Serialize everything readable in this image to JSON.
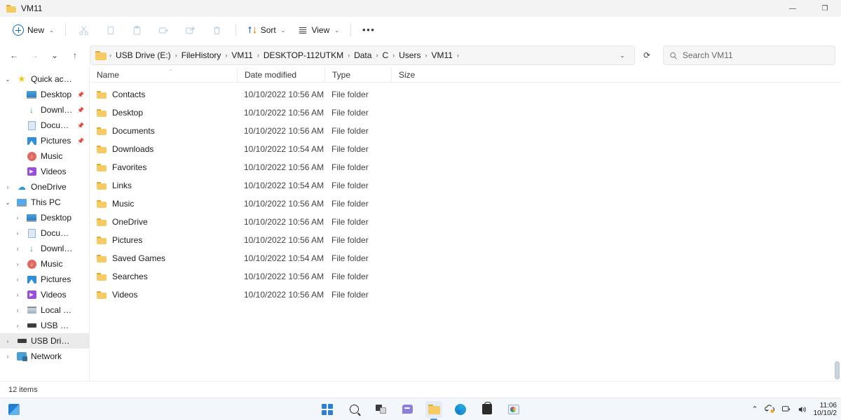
{
  "window": {
    "title": "VM11",
    "title_icon": "folder-icon",
    "controls": {
      "minimize": "—",
      "maximize": "❐",
      "close": "✕"
    }
  },
  "toolbar": {
    "new_label": "New",
    "new_caret": "⌄",
    "cut_icon": "cut-icon",
    "copy_icon": "copy-icon",
    "paste_icon": "paste-icon",
    "rename_icon": "rename-icon",
    "share_icon": "share-icon",
    "delete_icon": "delete-icon",
    "sort_label": "Sort",
    "sort_icon": "sort-icon",
    "view_label": "View",
    "view_icon": "view-icon",
    "more_label": "•••"
  },
  "address": {
    "back_icon": "←",
    "forward_icon": "→",
    "recent_icon": "⌄",
    "up_icon": "↑",
    "folder_icon": "folder-icon",
    "separator": "›",
    "crumbs": [
      "USB Drive (E:)",
      "FileHistory",
      "VM11",
      "DESKTOP-112UTKM",
      "Data",
      "C",
      "Users",
      "VM11"
    ],
    "dropdown_icon": "⌄",
    "refresh_icon": "⟳"
  },
  "search": {
    "icon": "search-icon",
    "placeholder": "Search VM11",
    "value": ""
  },
  "sidebar": {
    "items": [
      {
        "label": "Quick access",
        "icon": "star-icon",
        "indent": 0,
        "chevron": "open",
        "pinned": false,
        "selected": false
      },
      {
        "label": "Desktop",
        "icon": "desktop-icon",
        "indent": 1,
        "chevron": "none",
        "pinned": true,
        "selected": false
      },
      {
        "label": "Downloads",
        "icon": "download-icon",
        "indent": 1,
        "chevron": "none",
        "pinned": true,
        "selected": false
      },
      {
        "label": "Documents",
        "icon": "document-icon",
        "indent": 1,
        "chevron": "none",
        "pinned": true,
        "selected": false
      },
      {
        "label": "Pictures",
        "icon": "pictures-icon",
        "indent": 1,
        "chevron": "none",
        "pinned": true,
        "selected": false
      },
      {
        "label": "Music",
        "icon": "music-icon",
        "indent": 1,
        "chevron": "none",
        "pinned": false,
        "selected": false
      },
      {
        "label": "Videos",
        "icon": "video-icon",
        "indent": 1,
        "chevron": "none",
        "pinned": false,
        "selected": false
      },
      {
        "label": "OneDrive",
        "icon": "cloud-icon",
        "indent": 0,
        "chevron": "closed",
        "pinned": false,
        "selected": false
      },
      {
        "label": "This PC",
        "icon": "pc-icon",
        "indent": 0,
        "chevron": "open",
        "pinned": false,
        "selected": false
      },
      {
        "label": "Desktop",
        "icon": "desktop-icon",
        "indent": 1,
        "chevron": "closed",
        "pinned": false,
        "selected": false
      },
      {
        "label": "Documents",
        "icon": "document-icon",
        "indent": 1,
        "chevron": "closed",
        "pinned": false,
        "selected": false
      },
      {
        "label": "Downloads",
        "icon": "download-icon",
        "indent": 1,
        "chevron": "closed",
        "pinned": false,
        "selected": false
      },
      {
        "label": "Music",
        "icon": "music-icon",
        "indent": 1,
        "chevron": "closed",
        "pinned": false,
        "selected": false
      },
      {
        "label": "Pictures",
        "icon": "pictures-icon",
        "indent": 1,
        "chevron": "closed",
        "pinned": false,
        "selected": false
      },
      {
        "label": "Videos",
        "icon": "video-icon",
        "indent": 1,
        "chevron": "closed",
        "pinned": false,
        "selected": false
      },
      {
        "label": "Local Disk (C:)",
        "icon": "disk-icon",
        "indent": 1,
        "chevron": "closed",
        "pinned": false,
        "selected": false
      },
      {
        "label": "USB Drive (E:)",
        "icon": "usb-icon",
        "indent": 1,
        "chevron": "closed",
        "pinned": false,
        "selected": false
      },
      {
        "label": "USB Drive (E:)",
        "icon": "usb-icon",
        "indent": 0,
        "chevron": "closed",
        "pinned": false,
        "selected": true
      },
      {
        "label": "Network",
        "icon": "network-icon",
        "indent": 0,
        "chevron": "closed",
        "pinned": false,
        "selected": false
      }
    ]
  },
  "filelist": {
    "columns": [
      "Name",
      "Date modified",
      "Type",
      "Size"
    ],
    "sort_column": "Name",
    "sort_direction": "ascending",
    "sort_indicator": "⌃",
    "rows": [
      {
        "name": "Contacts",
        "date": "10/10/2022 10:56 AM",
        "type": "File folder",
        "size": ""
      },
      {
        "name": "Desktop",
        "date": "10/10/2022 10:56 AM",
        "type": "File folder",
        "size": ""
      },
      {
        "name": "Documents",
        "date": "10/10/2022 10:56 AM",
        "type": "File folder",
        "size": ""
      },
      {
        "name": "Downloads",
        "date": "10/10/2022 10:54 AM",
        "type": "File folder",
        "size": ""
      },
      {
        "name": "Favorites",
        "date": "10/10/2022 10:56 AM",
        "type": "File folder",
        "size": ""
      },
      {
        "name": "Links",
        "date": "10/10/2022 10:54 AM",
        "type": "File folder",
        "size": ""
      },
      {
        "name": "Music",
        "date": "10/10/2022 10:56 AM",
        "type": "File folder",
        "size": ""
      },
      {
        "name": "OneDrive",
        "date": "10/10/2022 10:56 AM",
        "type": "File folder",
        "size": ""
      },
      {
        "name": "Pictures",
        "date": "10/10/2022 10:56 AM",
        "type": "File folder",
        "size": ""
      },
      {
        "name": "Saved Games",
        "date": "10/10/2022 10:54 AM",
        "type": "File folder",
        "size": ""
      },
      {
        "name": "Searches",
        "date": "10/10/2022 10:56 AM",
        "type": "File folder",
        "size": ""
      },
      {
        "name": "Videos",
        "date": "10/10/2022 10:56 AM",
        "type": "File folder",
        "size": ""
      }
    ]
  },
  "statusbar": {
    "item_count": "12 items"
  },
  "taskbar": {
    "left_widget_icon": "widget-icon",
    "items": [
      {
        "name": "start-button",
        "icon": "windows-logo-icon",
        "active": false
      },
      {
        "name": "search-taskbar-button",
        "icon": "search-icon",
        "active": false
      },
      {
        "name": "task-view-button",
        "icon": "task-view-icon",
        "active": false
      },
      {
        "name": "chat-button",
        "icon": "chat-icon",
        "active": false
      },
      {
        "name": "file-explorer-button",
        "icon": "folder-icon",
        "active": true
      },
      {
        "name": "edge-button",
        "icon": "edge-icon",
        "active": false
      },
      {
        "name": "store-button",
        "icon": "store-icon",
        "active": false
      },
      {
        "name": "paint-button",
        "icon": "paint-icon",
        "active": false
      }
    ],
    "tray": {
      "overflow_icon": "⌃",
      "onedrive_icon": "onedrive-sync-icon",
      "network_icon": "network-icon",
      "volume_icon": "🔊",
      "time": "11:06",
      "date": "10/10/2"
    }
  },
  "colors": {
    "accent": "#0f6cbd",
    "folder": "#f7cb63",
    "selection": "#ebebeb"
  }
}
